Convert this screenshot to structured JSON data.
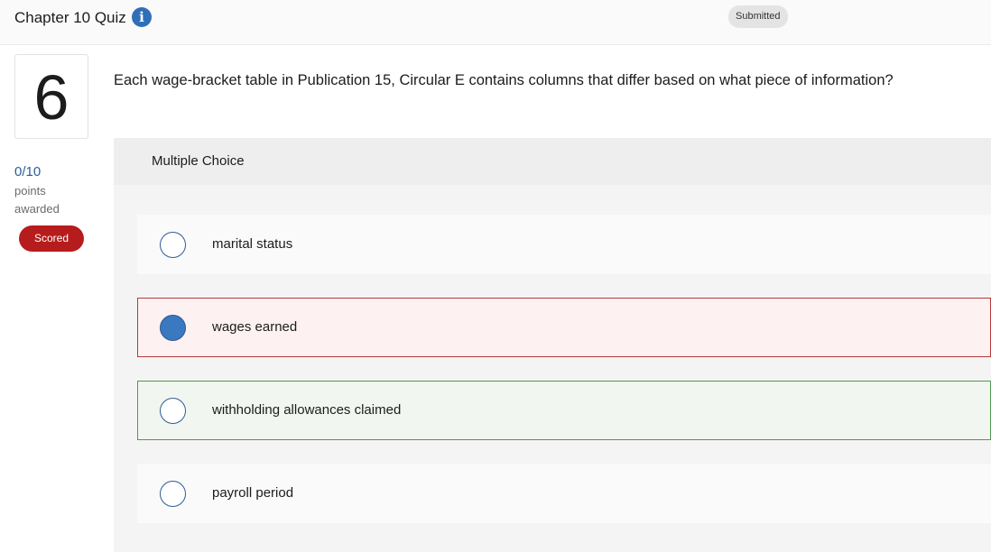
{
  "header": {
    "title": "Chapter 10 Quiz",
    "info_icon": "info-icon",
    "status": "Submitted"
  },
  "question": {
    "number": "6",
    "points": "0/10",
    "points_label": "points awarded",
    "badge": "Scored",
    "text": "Each wage-bracket table in Publication 15, Circular E contains columns that differ based on what piece of information?",
    "type_label": "Multiple Choice",
    "options": [
      {
        "label": "marital status",
        "selected": false,
        "state": "neutral"
      },
      {
        "label": "wages earned",
        "selected": true,
        "state": "incorrect"
      },
      {
        "label": "withholding allowances claimed",
        "selected": false,
        "state": "correct"
      },
      {
        "label": "payroll period",
        "selected": false,
        "state": "neutral"
      }
    ]
  },
  "colors": {
    "accent": "#2f6fb8",
    "scored_badge": "#b71c1c",
    "incorrect_border": "#b33a3a",
    "correct_border": "#4f9a4f"
  }
}
